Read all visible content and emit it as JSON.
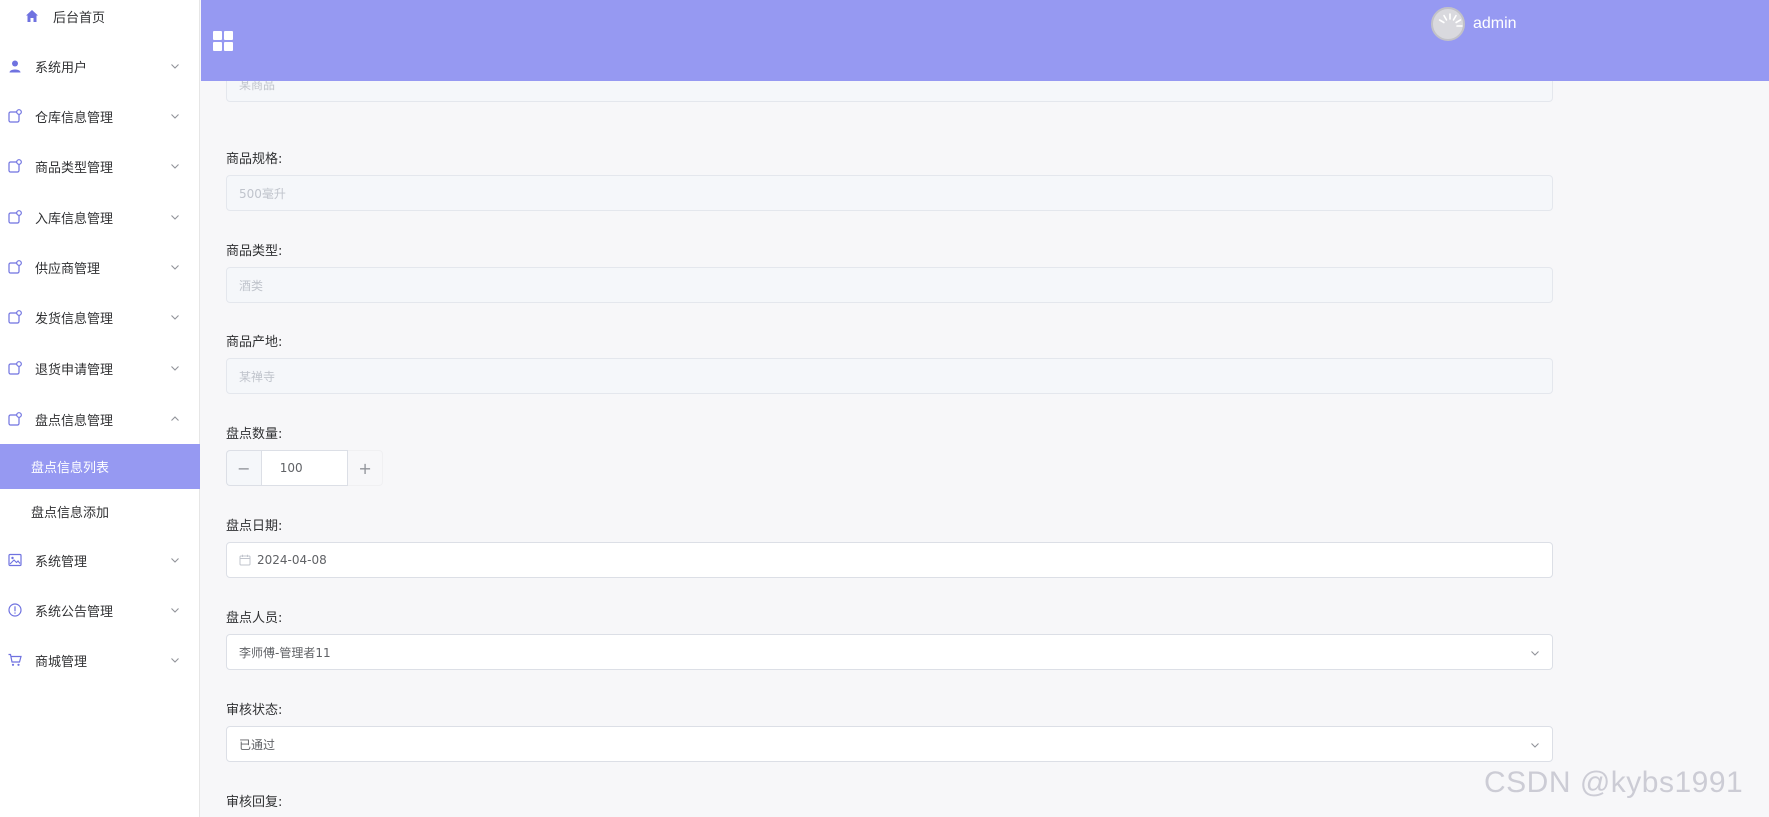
{
  "sidebar": {
    "home": {
      "label": "后台首页",
      "icon": "home-icon"
    },
    "items": [
      {
        "label": "系统用户",
        "icon": "user-icon"
      },
      {
        "label": "仓库信息管理",
        "icon": "folder-icon"
      },
      {
        "label": "商品类型管理",
        "icon": "folder-icon"
      },
      {
        "label": "入库信息管理",
        "icon": "folder-icon"
      },
      {
        "label": "供应商管理",
        "icon": "folder-icon"
      },
      {
        "label": "发货信息管理",
        "icon": "folder-icon"
      },
      {
        "label": "退货申请管理",
        "icon": "folder-icon"
      },
      {
        "label": "盘点信息管理",
        "icon": "folder-icon",
        "expanded": true
      },
      {
        "label": "系统管理",
        "icon": "picture-icon"
      },
      {
        "label": "系统公告管理",
        "icon": "info-icon"
      },
      {
        "label": "商城管理",
        "icon": "cart-icon"
      }
    ],
    "subitems": [
      {
        "label": "盘点信息列表",
        "active": true
      },
      {
        "label": "盘点信息添加",
        "active": false
      }
    ]
  },
  "header": {
    "username": "admin",
    "menu_icon": "grid-icon"
  },
  "form": {
    "top_partial_value": "某商品",
    "spec": {
      "label": "商品规格:",
      "value": "500毫升"
    },
    "type": {
      "label": "商品类型:",
      "value": "酒类"
    },
    "origin": {
      "label": "商品产地:",
      "value": "某禅寺"
    },
    "quantity": {
      "label": "盘点数量:",
      "value": "100",
      "minus": "−",
      "plus": "+"
    },
    "date": {
      "label": "盘点日期:",
      "value": "2024-04-08"
    },
    "staff": {
      "label": "盘点人员:",
      "value": "李师傅-管理者11"
    },
    "status": {
      "label": "审核状态:",
      "value": "已通过"
    },
    "reply": {
      "label": "审核回复:"
    }
  },
  "watermark": "CSDN @kybs1991",
  "colors": {
    "accent": "#9699f2",
    "icon": "#6f72e0"
  }
}
